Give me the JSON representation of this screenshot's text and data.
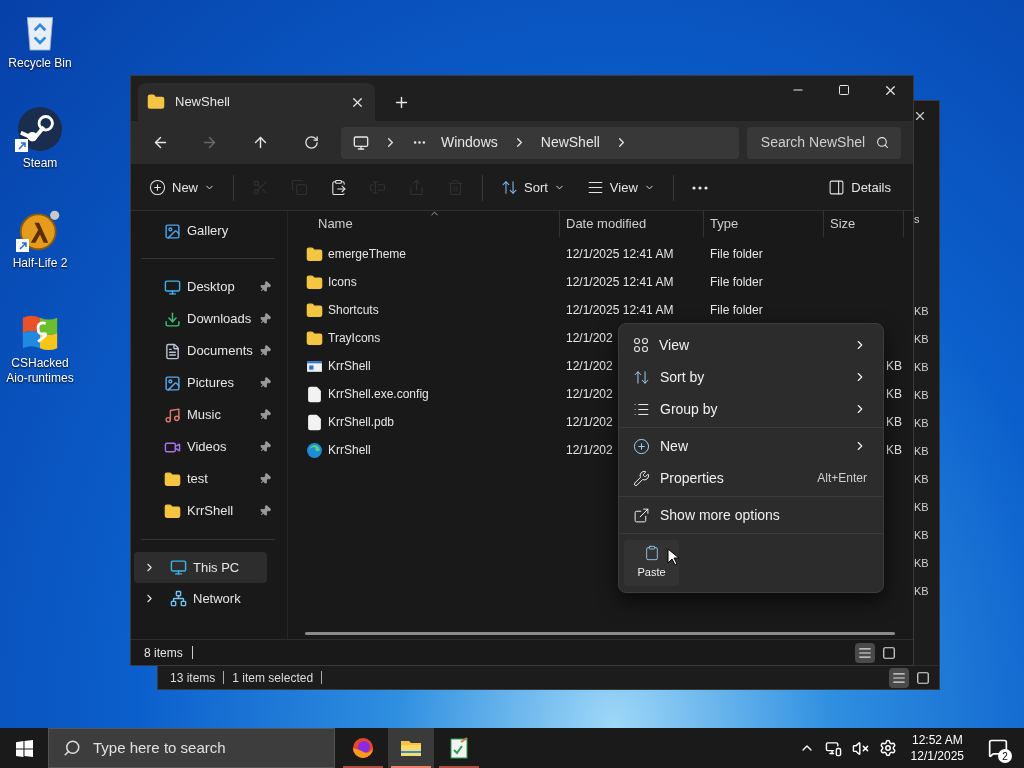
{
  "desktop_icons": [
    {
      "label": "Recycle Bin",
      "kind": "recycle",
      "shortcut": false
    },
    {
      "label": "Steam",
      "kind": "steam",
      "shortcut": true
    },
    {
      "label": "Half-Life 2",
      "kind": "halflife",
      "shortcut": true
    },
    {
      "label": "CSHacked Aio-runtimes",
      "kind": "flag",
      "shortcut": false
    }
  ],
  "back_window": {
    "column_fragment": "s",
    "size_fragments": [
      "KB",
      "KB",
      "KB",
      "KB",
      "KB",
      "KB",
      "KB",
      "KB",
      "KB",
      "KB",
      "KB"
    ],
    "status": [
      "13 items",
      "1 item selected"
    ],
    "view_buttons": [
      {
        "kind": "details",
        "selected": true
      },
      {
        "kind": "tiles",
        "selected": false
      }
    ]
  },
  "window": {
    "tab": {
      "title": "NewShell"
    },
    "breadcrumb": [
      "Windows",
      "NewShell"
    ],
    "search": {
      "placeholder": "Search NewShel"
    },
    "toolbar": [
      {
        "kind": "new",
        "label": "New",
        "disabled": false
      },
      {
        "kind": "cut",
        "disabled": true
      },
      {
        "kind": "copy",
        "disabled": true
      },
      {
        "kind": "paste",
        "disabled": false
      },
      {
        "kind": "rename",
        "disabled": true
      },
      {
        "kind": "share",
        "disabled": true
      },
      {
        "kind": "delete",
        "disabled": true
      },
      {
        "kind": "sort",
        "label": "Sort",
        "disabled": false
      },
      {
        "kind": "view",
        "label": "View",
        "disabled": false
      },
      {
        "kind": "more",
        "disabled": false
      },
      {
        "kind": "details",
        "label": "Details",
        "disabled": false
      }
    ],
    "sidebar": {
      "top": [
        {
          "label": "Gallery",
          "kind": "gallery"
        }
      ],
      "quick_access": [
        {
          "label": "Desktop",
          "kind": "desktop",
          "pinned": true
        },
        {
          "label": "Downloads",
          "kind": "downloads",
          "pinned": true
        },
        {
          "label": "Documents",
          "kind": "documents",
          "pinned": true
        },
        {
          "label": "Pictures",
          "kind": "pictures",
          "pinned": true
        },
        {
          "label": "Music",
          "kind": "music",
          "pinned": true
        },
        {
          "label": "Videos",
          "kind": "videos",
          "pinned": true
        },
        {
          "label": "test",
          "kind": "folder",
          "pinned": true
        },
        {
          "label": "KrrShell",
          "kind": "folder",
          "pinned": true
        }
      ],
      "locations": [
        {
          "label": "This PC",
          "kind": "pc",
          "selected": true
        },
        {
          "label": "Network",
          "kind": "network",
          "selected": false
        }
      ]
    },
    "columns": [
      "Name",
      "Date modified",
      "Type",
      "Size"
    ],
    "rows": [
      {
        "name": "emergeTheme",
        "kind": "folder",
        "date": "12/1/2025 12:41 AM",
        "type": "File folder"
      },
      {
        "name": "Icons",
        "kind": "folder",
        "date": "12/1/2025 12:41 AM",
        "type": "File folder"
      },
      {
        "name": "Shortcuts",
        "kind": "folder",
        "date": "12/1/2025 12:41 AM",
        "type": "File folder"
      },
      {
        "name": "TrayIcons",
        "kind": "folder",
        "date": "12/1/202"
      },
      {
        "name": "KrrShell",
        "kind": "app",
        "date": "12/1/202",
        "size": "KB"
      },
      {
        "name": "KrrShell.exe.config",
        "kind": "file",
        "date": "12/1/202",
        "size": "KB"
      },
      {
        "name": "KrrShell.pdb",
        "kind": "file",
        "date": "12/1/202",
        "size": "KB"
      },
      {
        "name": "KrrShell",
        "kind": "edge",
        "date": "12/1/202",
        "size": "KB"
      }
    ],
    "status": "8 items",
    "view_buttons": [
      {
        "kind": "details",
        "selected": true
      },
      {
        "kind": "tiles",
        "selected": false
      }
    ]
  },
  "context_menu": {
    "groups": [
      [
        {
          "label": "View",
          "kind": "grid",
          "submenu": true
        },
        {
          "label": "Sort by",
          "kind": "sort",
          "submenu": true
        },
        {
          "label": "Group by",
          "kind": "group",
          "submenu": true
        }
      ],
      [
        {
          "label": "New",
          "kind": "new",
          "submenu": true
        },
        {
          "label": "Properties",
          "kind": "wrench",
          "submenu": false,
          "shortcut": "Alt+Enter"
        }
      ],
      [
        {
          "label": "Show more options",
          "kind": "more",
          "submenu": false
        }
      ]
    ],
    "actions": [
      {
        "label": "Paste",
        "kind": "paste"
      }
    ]
  },
  "taskbar": {
    "search": {
      "placeholder": "Type here to search"
    },
    "apps": [
      {
        "kind": "firefox",
        "active": false
      },
      {
        "kind": "explorer",
        "active": true
      },
      {
        "kind": "editor",
        "active": false
      }
    ],
    "time": "12:52 AM",
    "date": "12/1/2025",
    "notifications": "2"
  }
}
